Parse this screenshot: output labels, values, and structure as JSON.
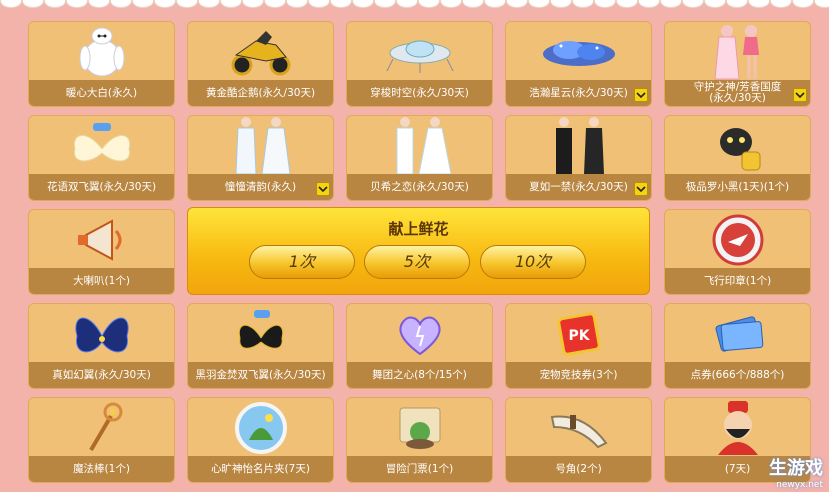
{
  "panel": {
    "title": "献上鲜花",
    "buttons": [
      {
        "label": "1次"
      },
      {
        "label": "5次"
      },
      {
        "label": "10次"
      }
    ]
  },
  "items": [
    {
      "label": "暖心大白(永久)",
      "icon": "white-robot-icon"
    },
    {
      "label": "黄金酷企鹅(永久/30天)",
      "icon": "golden-penguin-mount-icon"
    },
    {
      "label": "穿梭时空(永久/30天)",
      "icon": "time-machine-icon"
    },
    {
      "label": "浩瀚星云(永久/30天)",
      "icon": "nebula-cloud-icon"
    },
    {
      "label": "守护之神/芳香国度",
      "label2": "(永久/30天)",
      "icon": "guardian-outfit-icon"
    },
    {
      "label": "花语双飞翼(永久/30天)",
      "icon": "flower-wings-icon"
    },
    {
      "label": "憧憧清韵(永久)",
      "icon": "white-outfit-pair-icon"
    },
    {
      "label": "贝希之恋(永久/30天)",
      "icon": "wedding-outfit-pair-icon"
    },
    {
      "label": "夏如一禁(永久/30天)",
      "icon": "black-outfit-pair-icon"
    },
    {
      "label": "极品罗小黑(1天)(1个)",
      "icon": "black-cat-icon"
    },
    {
      "label": "大喇叭(1个)",
      "icon": "megaphone-icon"
    },
    {
      "label": "飞行印章(1个)",
      "icon": "flight-stamp-icon"
    },
    {
      "label": "真如幻翼(永久/30天)",
      "icon": "blue-wings-icon"
    },
    {
      "label": "黑羽金焚双飞翼(永久/30天)",
      "icon": "black-gold-wings-icon"
    },
    {
      "label": "舞团之心(8个/15个)",
      "icon": "crystal-heart-icon"
    },
    {
      "label": "宠物竞技券(3个)",
      "icon": "pk-ticket-icon"
    },
    {
      "label": "点券(666个/888个)",
      "icon": "coupon-icon"
    },
    {
      "label": "魔法棒(1个)",
      "icon": "magic-wand-icon"
    },
    {
      "label": "心旷神怡名片夹(7天)",
      "icon": "card-holder-icon"
    },
    {
      "label": "冒险门票(1个)",
      "icon": "adventure-ticket-icon"
    },
    {
      "label": "号角(2个)",
      "icon": "horn-icon"
    },
    {
      "label": "(7天)",
      "icon": "fortune-god-icon"
    }
  ],
  "watermark": {
    "text": "生游戏",
    "sub": "newyx.net"
  }
}
